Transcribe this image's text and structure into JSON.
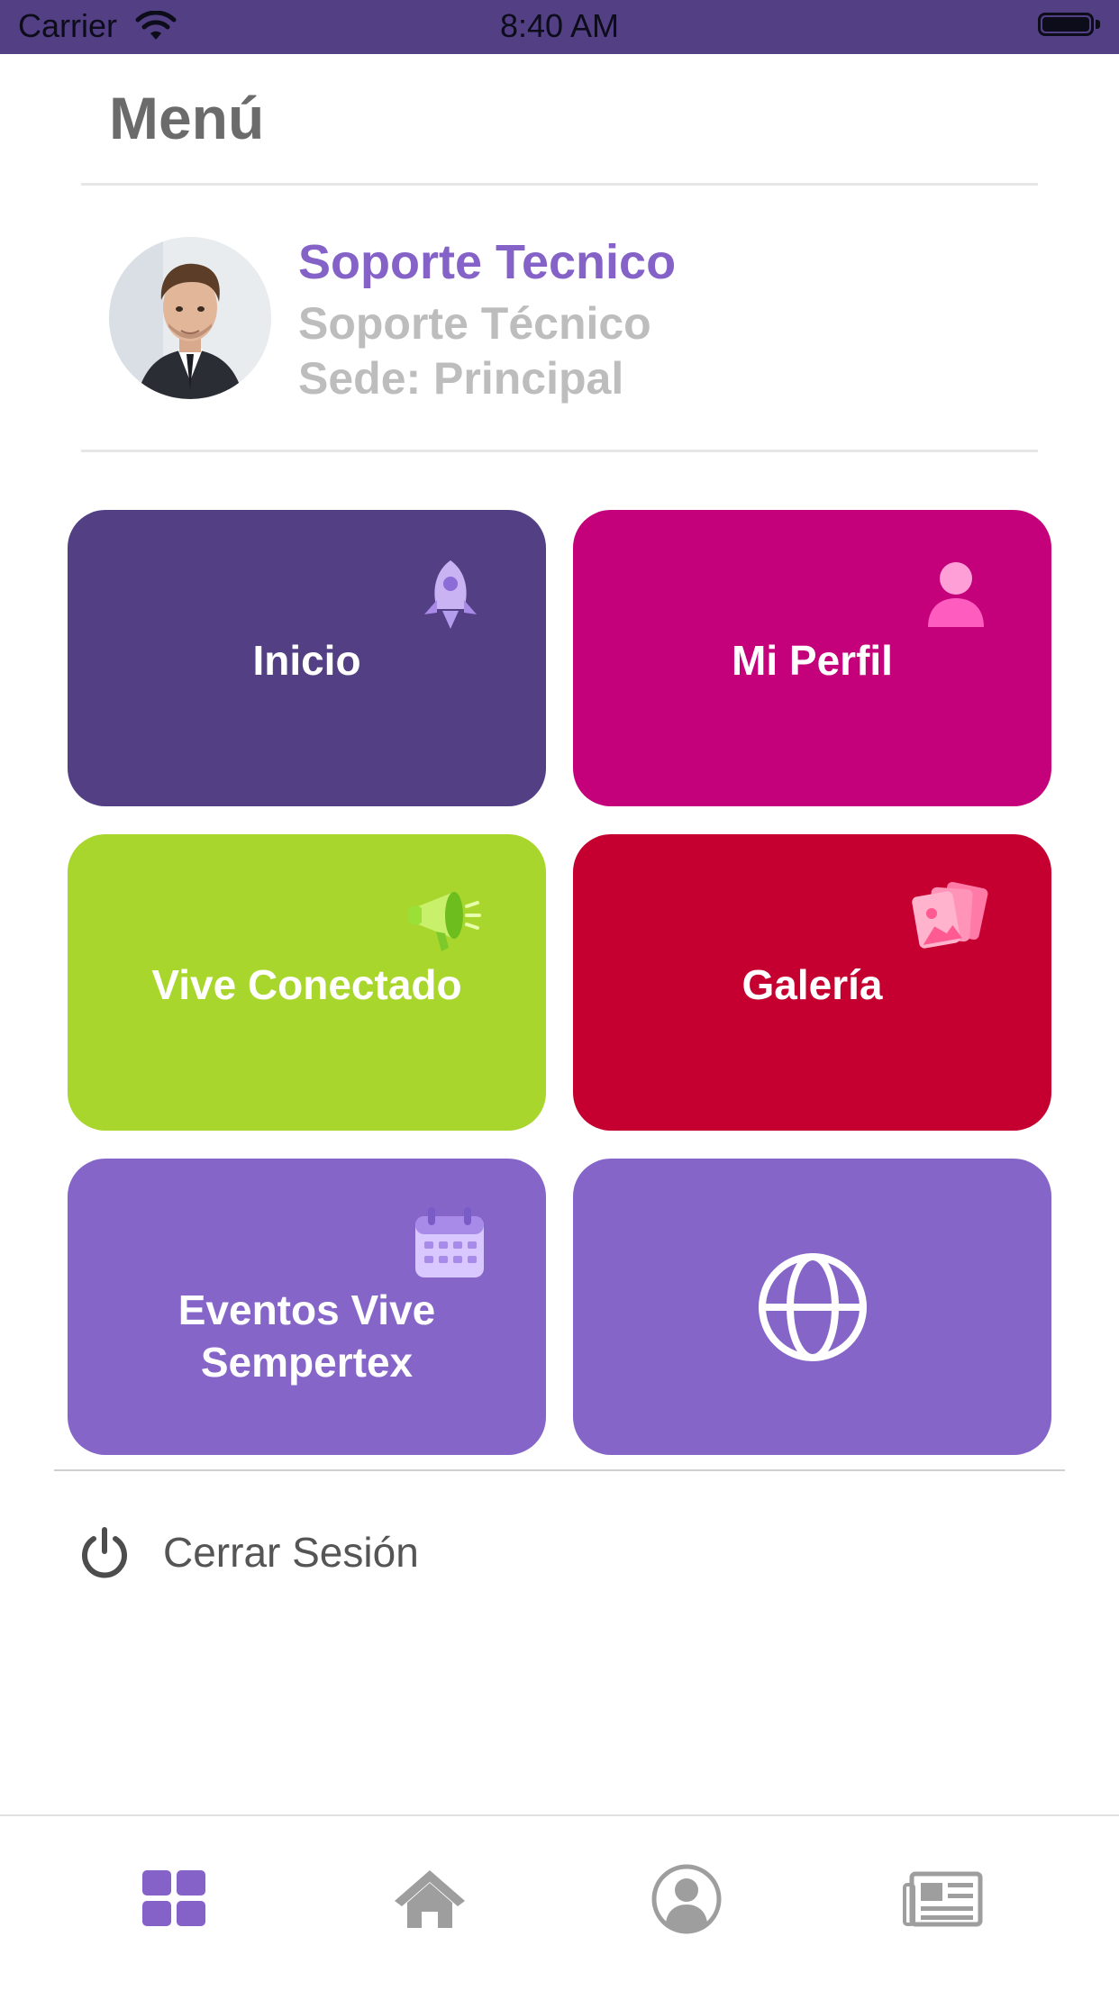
{
  "status_bar": {
    "carrier": "Carrier",
    "time": "8:40 AM"
  },
  "menu": {
    "title": "Menú"
  },
  "profile": {
    "name": "Soporte Tecnico",
    "role": "Soporte Técnico",
    "site": "Sede: Principal"
  },
  "tiles": [
    {
      "label": "Inicio",
      "color": "#533f84",
      "icon": "rocket-icon"
    },
    {
      "label": "Mi Perfil",
      "color": "#c4007b",
      "icon": "person-icon"
    },
    {
      "label": "Vive Conectado",
      "color": "#a8d62c",
      "icon": "megaphone-icon"
    },
    {
      "label": "Galería",
      "color": "#c50030",
      "icon": "photos-icon"
    },
    {
      "label_line1": "Eventos Vive",
      "label_line2": "Sempertex",
      "color": "#8566c8",
      "icon": "calendar-icon"
    },
    {
      "label": "",
      "color": "#8566c8",
      "icon": "globe-icon"
    }
  ],
  "logout": {
    "label": "Cerrar Sesión"
  },
  "tabbar": {
    "items": [
      {
        "icon": "grid-icon",
        "active": true
      },
      {
        "icon": "home-icon",
        "active": false
      },
      {
        "icon": "profile-icon",
        "active": false
      },
      {
        "icon": "news-icon",
        "active": false
      }
    ],
    "active_color": "#8462c7",
    "inactive_color": "#9e9e9e"
  }
}
